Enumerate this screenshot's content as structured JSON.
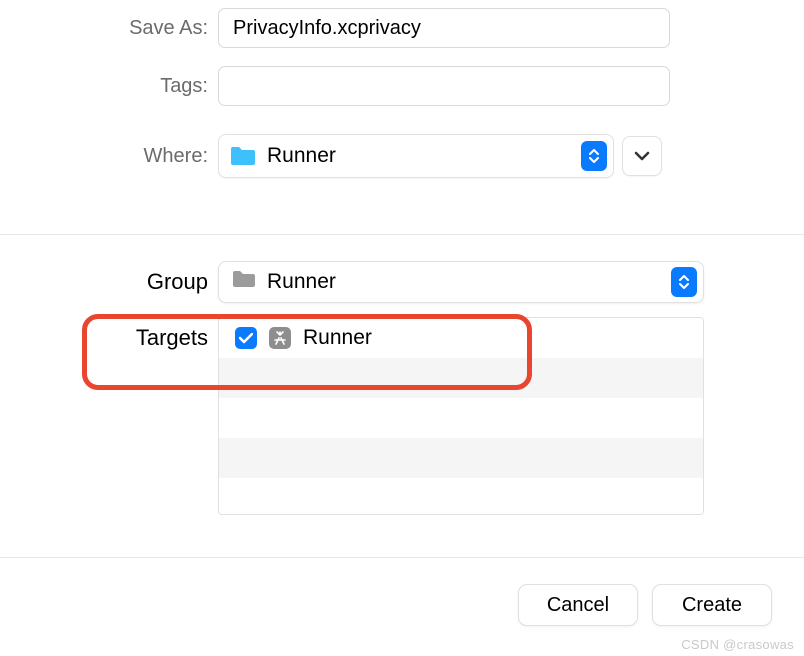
{
  "saveAs": {
    "label": "Save As:",
    "value": "PrivacyInfo.xcprivacy"
  },
  "tags": {
    "label": "Tags:",
    "value": ""
  },
  "where": {
    "label": "Where:",
    "selected": "Runner"
  },
  "group": {
    "label": "Group",
    "selected": "Runner"
  },
  "targets": {
    "label": "Targets",
    "items": [
      {
        "name": "Runner",
        "checked": true
      }
    ]
  },
  "buttons": {
    "cancel": "Cancel",
    "create": "Create"
  },
  "watermark": "CSDN @crasowas",
  "colors": {
    "accent": "#0a7aff",
    "highlight": "#e8462f",
    "folder": "#3dc0fb"
  }
}
